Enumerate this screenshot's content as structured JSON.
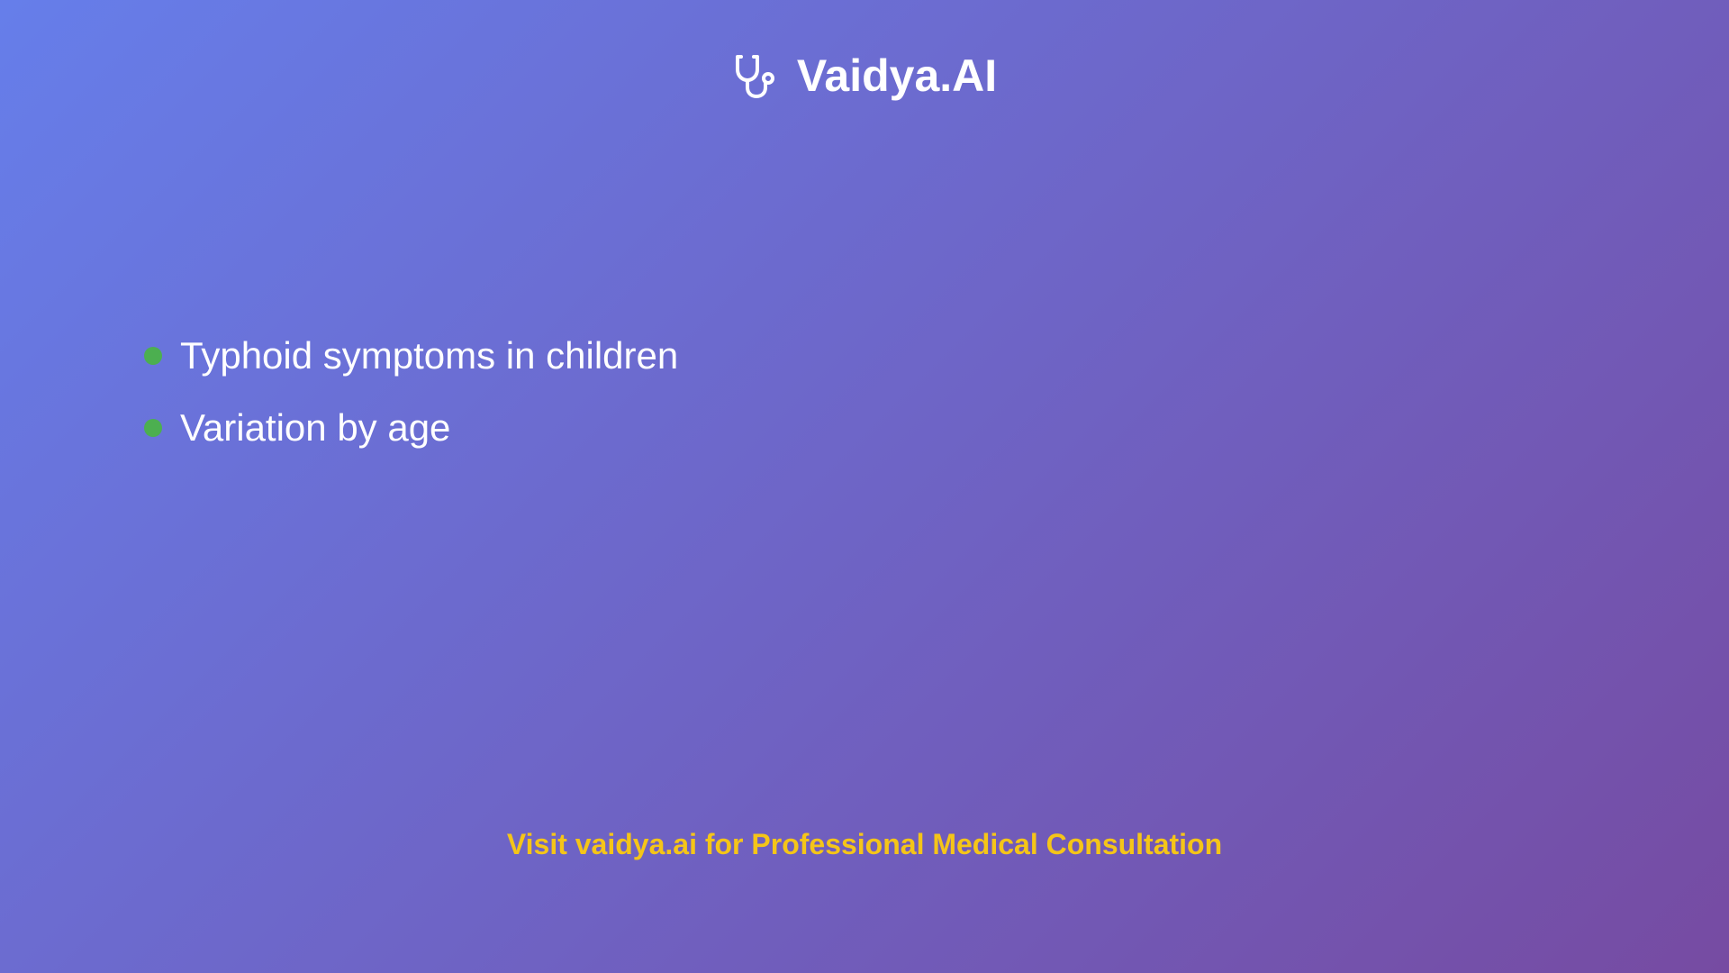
{
  "header": {
    "icon": "stethoscope-icon",
    "title": "Vaidya.AI"
  },
  "bullets": [
    {
      "text": "Typhoid symptoms in children"
    },
    {
      "text": "Variation by age"
    }
  ],
  "footer": {
    "text": "Visit vaidya.ai for Professional Medical Consultation"
  },
  "colors": {
    "background_start": "#667eea",
    "background_end": "#764ba2",
    "bullet": "#4caf50",
    "footer_text": "#f5c518",
    "text": "#ffffff"
  }
}
